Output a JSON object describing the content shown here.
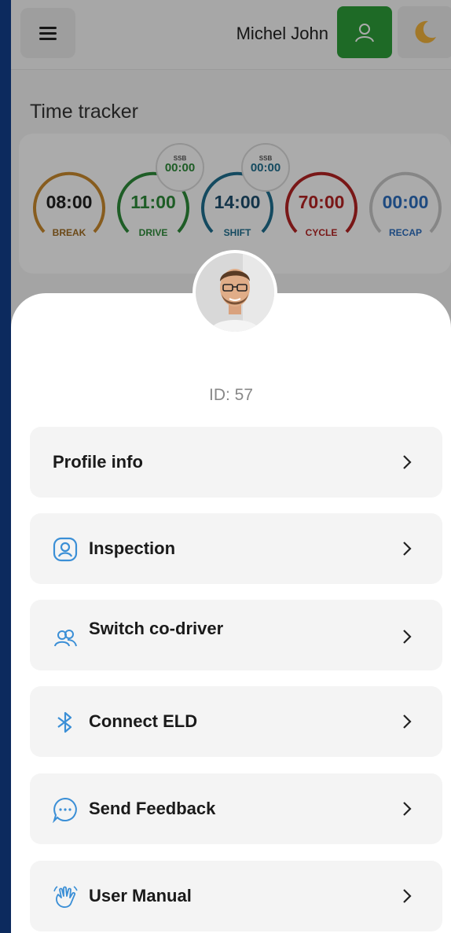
{
  "header": {
    "user_name": "Michel John",
    "icons": [
      "menu-icon",
      "user-icon",
      "moon-icon"
    ]
  },
  "time_tracker": {
    "title": "Time tracker",
    "gauges": [
      {
        "value": "08:00",
        "label": "BREAK",
        "color": "#c98a2e"
      },
      {
        "value": "11:00",
        "label": "DRIVE",
        "color": "#2e8b3a",
        "ssb_label": "SSB",
        "ssb_value": "00:00"
      },
      {
        "value": "14:00",
        "label": "SHIFT",
        "color": "#1f6f8f",
        "ssb_label": "SSB",
        "ssb_value": "00:00"
      },
      {
        "value": "70:00",
        "label": "CYCLE",
        "color": "#b52323"
      },
      {
        "value": "00:00",
        "label": "RECAP",
        "color": "#2e6fbf"
      }
    ]
  },
  "profile_sheet": {
    "id_text": "ID: 57",
    "items": [
      {
        "label": "Profile info",
        "icon": null
      },
      {
        "label": "Inspection",
        "icon": "inspection-icon"
      },
      {
        "label": "Switch co-driver",
        "icon": "users-icon"
      },
      {
        "label": "Connect ELD",
        "icon": "bluetooth-icon"
      },
      {
        "label": "Send Feedback",
        "icon": "chat-bubble-icon"
      },
      {
        "label": "User Manual",
        "icon": "hand-wave-icon"
      }
    ]
  },
  "colors": {
    "accent_green": "#2e9e3a",
    "icon_blue": "#3b8fd6",
    "frame": "#0c2a5e"
  }
}
